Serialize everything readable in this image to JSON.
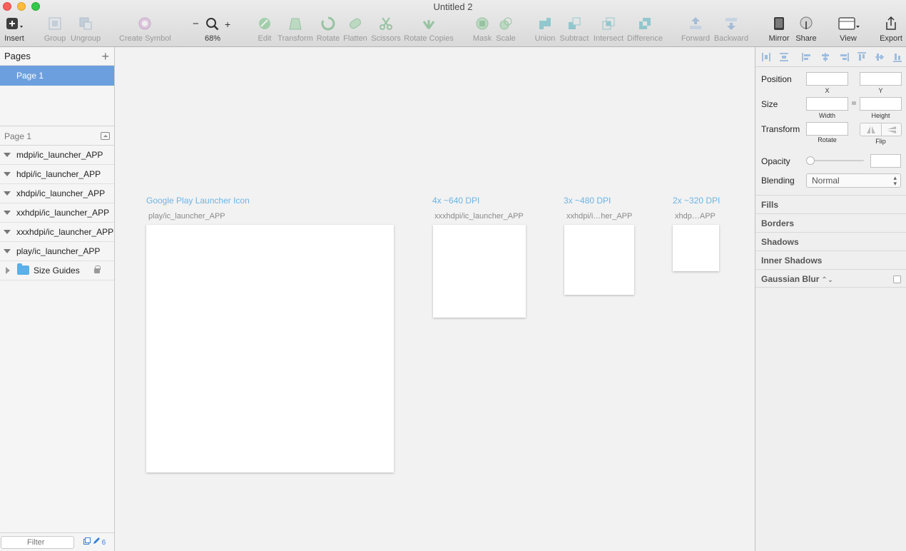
{
  "window": {
    "title": "Untitled 2"
  },
  "toolbar": {
    "items": [
      {
        "label": "Insert",
        "icon": "plus-box-icon"
      },
      {
        "label": "Group",
        "icon": "group-icon"
      },
      {
        "label": "Ungroup",
        "icon": "ungroup-icon"
      },
      {
        "label": "Create Symbol",
        "icon": "symbol-icon"
      },
      {
        "label": "68%",
        "icon": "zoom-icon"
      },
      {
        "label": "Edit",
        "icon": "edit-icon"
      },
      {
        "label": "Transform",
        "icon": "transform-icon"
      },
      {
        "label": "Rotate",
        "icon": "rotate-icon"
      },
      {
        "label": "Flatten",
        "icon": "flatten-icon"
      },
      {
        "label": "Scissors",
        "icon": "scissors-icon"
      },
      {
        "label": "Rotate Copies",
        "icon": "rotate-copies-icon"
      },
      {
        "label": "Mask",
        "icon": "mask-icon"
      },
      {
        "label": "Scale",
        "icon": "scale-icon"
      },
      {
        "label": "Union",
        "icon": "union-icon"
      },
      {
        "label": "Subtract",
        "icon": "subtract-icon"
      },
      {
        "label": "Intersect",
        "icon": "intersect-icon"
      },
      {
        "label": "Difference",
        "icon": "difference-icon"
      },
      {
        "label": "Forward",
        "icon": "forward-icon"
      },
      {
        "label": "Backward",
        "icon": "backward-icon"
      },
      {
        "label": "Mirror",
        "icon": "mirror-icon"
      },
      {
        "label": "Share",
        "icon": "share-icon"
      },
      {
        "label": "View",
        "icon": "view-icon"
      },
      {
        "label": "Export",
        "icon": "export-icon"
      }
    ],
    "zoom_minus": "−",
    "zoom_plus": "+"
  },
  "pages": {
    "header": "Pages",
    "add_symbol": "+",
    "items": [
      {
        "label": "Page 1",
        "selected": true
      }
    ]
  },
  "layers": {
    "header": "Page 1",
    "items": [
      {
        "label": "mdpi/ic_launcher_APP"
      },
      {
        "label": "hdpi/ic_launcher_APP"
      },
      {
        "label": "xhdpi/ic_launcher_APP"
      },
      {
        "label": "xxhdpi/ic_launcher_APP"
      },
      {
        "label": "xxxhdpi/ic_launcher_APP"
      },
      {
        "label": "play/ic_launcher_APP"
      }
    ],
    "group": {
      "label": "Size Guides",
      "locked": true
    }
  },
  "filter": {
    "placeholder": "Filter",
    "count": "6"
  },
  "canvas": {
    "artboards": [
      {
        "title": "Google Play Launcher Icon",
        "name": "play/ic_launcher_APP"
      },
      {
        "title": "4x ~640 DPI",
        "name": "xxxhdpi/ic_launcher_APP"
      },
      {
        "title": "3x ~480 DPI",
        "name": "xxhdpi/i…her_APP"
      },
      {
        "title": "2x ~320 DPI",
        "name": "xhdp…APP"
      }
    ]
  },
  "inspector": {
    "position_label": "Position",
    "x_caption": "X",
    "y_caption": "Y",
    "size_label": "Size",
    "width_caption": "Width",
    "height_caption": "Height",
    "transform_label": "Transform",
    "rotate_caption": "Rotate",
    "flip_caption": "Flip",
    "opacity_label": "Opacity",
    "blending_label": "Blending",
    "blending_value": "Normal",
    "sections": [
      "Fills",
      "Borders",
      "Shadows",
      "Inner Shadows",
      "Gaussian Blur"
    ]
  },
  "colors": {
    "accent": "#6c9fde",
    "artboard_label": "#6cb4e4"
  }
}
